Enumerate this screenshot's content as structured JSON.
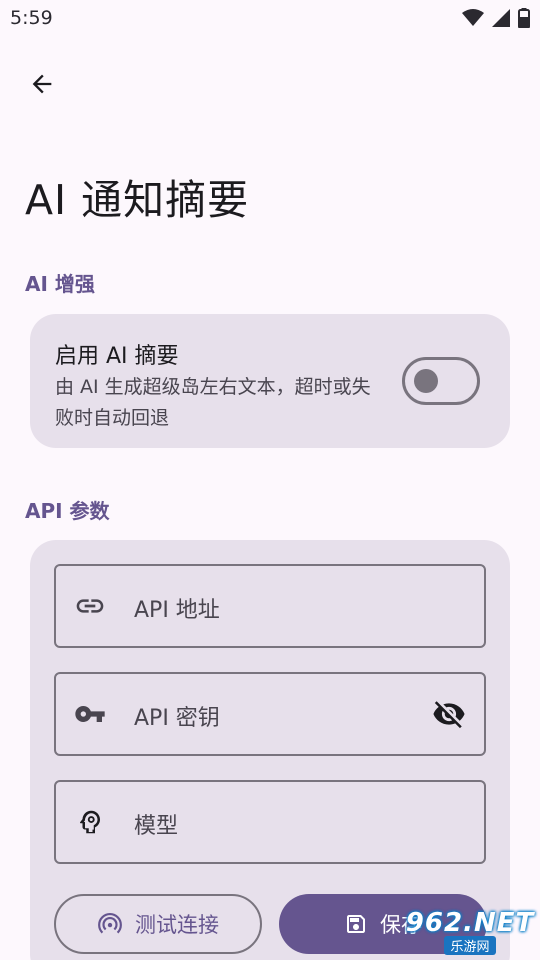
{
  "status_bar": {
    "time": "5:59",
    "icons": [
      "wifi-icon",
      "signal-icon",
      "battery-icon"
    ]
  },
  "header": {
    "back_icon": "arrow-back-icon",
    "title": "AI 通知摘要"
  },
  "ai_section": {
    "label": "AI 增强",
    "enable": {
      "title": "启用 AI 摘要",
      "description": "由 AI 生成超级岛左右文本，超时或失败时自动回退",
      "toggle_on": false
    }
  },
  "api_section": {
    "label": "API 参数",
    "fields": {
      "url": {
        "label": "API 地址",
        "icon": "link-icon"
      },
      "key": {
        "label": "API 密钥",
        "icon": "key-icon",
        "trailing_icon": "visibility-off-icon"
      },
      "model": {
        "label": "模型",
        "icon": "psychology-icon"
      }
    },
    "buttons": {
      "test": {
        "label": "测试连接",
        "icon": "wireless-icon"
      },
      "save": {
        "label": "保存",
        "icon": "save-icon"
      }
    }
  },
  "watermark": {
    "main": "962.NET",
    "sub": "乐游网"
  },
  "colors": {
    "background": "#fdf8fd",
    "card": "#e7e0eb",
    "accent": "#65558f",
    "outline": "#79747e"
  }
}
